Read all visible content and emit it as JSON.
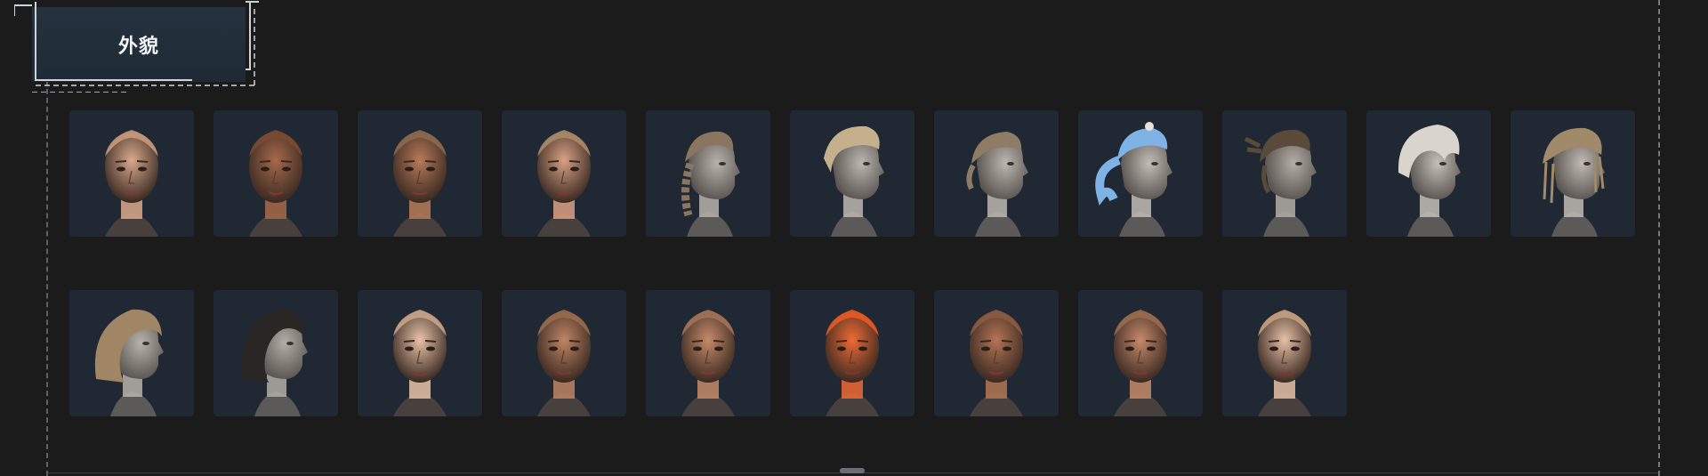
{
  "header": {
    "title": "外貌"
  },
  "appearance_options": [
    {
      "kind": "front",
      "skin": "#d9a98b",
      "hair": "#c99a7d",
      "style": "bald"
    },
    {
      "kind": "front",
      "skin": "#a8694a",
      "hair": "#7a4a30",
      "style": "buzz"
    },
    {
      "kind": "front",
      "skin": "#b77a58",
      "hair": "#8b6a4e",
      "style": "buzz"
    },
    {
      "kind": "front",
      "skin": "#d9a184",
      "hair": "#a88a6a",
      "style": "buzz"
    },
    {
      "kind": "side",
      "skin": "#b9b3ac",
      "hair": "#8a7560",
      "style": "braid"
    },
    {
      "kind": "side",
      "skin": "#bdb7b0",
      "hair": "#c4b08c",
      "style": "short"
    },
    {
      "kind": "side",
      "skin": "#bdb7b0",
      "hair": "#8f7c66",
      "style": "bun"
    },
    {
      "kind": "side",
      "skin": "#c3bdb6",
      "hair": "#7fb3e6",
      "style": "ponytail"
    },
    {
      "kind": "side",
      "skin": "#b4aea7",
      "hair": "#5a4a3a",
      "style": "cornrows"
    },
    {
      "kind": "side",
      "skin": "#c6c0b9",
      "hair": "#d9d4cc",
      "style": "messy"
    },
    {
      "kind": "side",
      "skin": "#c1bbb4",
      "hair": "#a08a6a",
      "style": "beads"
    },
    {
      "kind": "side",
      "skin": "#b9b3ac",
      "hair": "#a08664",
      "style": "bob"
    },
    {
      "kind": "side",
      "skin": "#b4aea7",
      "hair": "#2a2624",
      "style": "shag"
    },
    {
      "kind": "front",
      "skin": "#e8c2a8",
      "hair": "#c8a489",
      "style": "bald"
    },
    {
      "kind": "front",
      "skin": "#c08564",
      "hair": "#9a6a4c",
      "style": "bald"
    },
    {
      "kind": "front",
      "skin": "#c68b69",
      "hair": "#a2725a",
      "style": "bald"
    },
    {
      "kind": "front",
      "skin": "#f06a34",
      "hair": "#e85a24",
      "style": "bald"
    },
    {
      "kind": "front",
      "skin": "#b47554",
      "hair": "#8c5a40",
      "style": "bald"
    },
    {
      "kind": "front",
      "skin": "#c7896a",
      "hair": "#9a6a4e",
      "style": "bald"
    },
    {
      "kind": "front",
      "skin": "#e6c0a6",
      "hair": "#c4a07f",
      "style": "bald"
    }
  ]
}
